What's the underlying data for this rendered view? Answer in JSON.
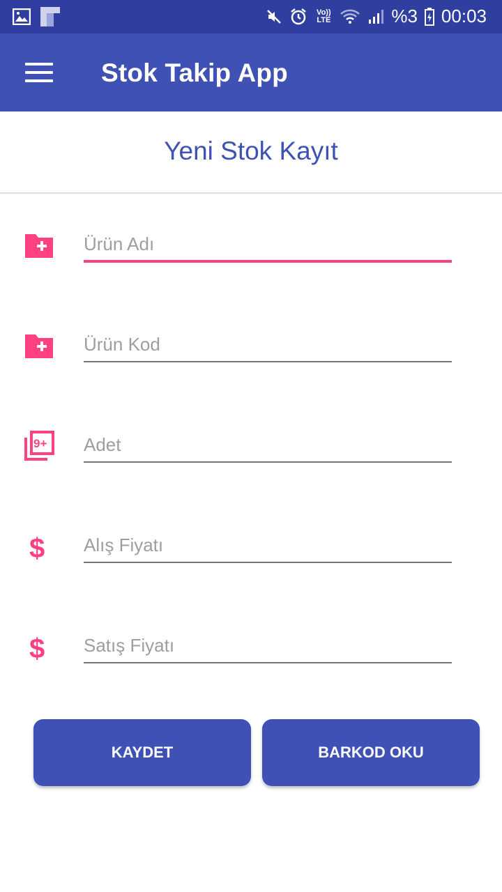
{
  "status_bar": {
    "battery_text": "%3",
    "time": "00:03",
    "network_label": "Vo)) LTE",
    "icons": [
      "gallery-icon",
      "flipboard-icon",
      "mute-icon",
      "alarm-icon",
      "volte-icon",
      "wifi-icon",
      "signal-icon",
      "battery-icon"
    ]
  },
  "app_bar": {
    "title": "Stok Takip App",
    "menu_icon": "hamburger-menu-icon",
    "color": "#3F51B5"
  },
  "page": {
    "title": "Yeni Stok Kayıt"
  },
  "form": {
    "fields": [
      {
        "placeholder": "Ürün Adı",
        "value": "",
        "icon": "folder-add-icon"
      },
      {
        "placeholder": "Ürün Kod",
        "value": "",
        "icon": "folder-add-icon"
      },
      {
        "placeholder": "Adet",
        "value": "",
        "icon": "filter-9-plus-icon"
      },
      {
        "placeholder": "Alış Fiyatı",
        "value": "",
        "icon": "dollar-icon"
      },
      {
        "placeholder": "Satış Fiyatı",
        "value": "",
        "icon": "dollar-icon"
      }
    ]
  },
  "buttons": {
    "save_label": "KAYDET",
    "barcode_label": "BARKOD OKU"
  },
  "colors": {
    "primary": "#3F51B5",
    "primary_dark": "#303F9F",
    "accent": "#FF4081"
  }
}
